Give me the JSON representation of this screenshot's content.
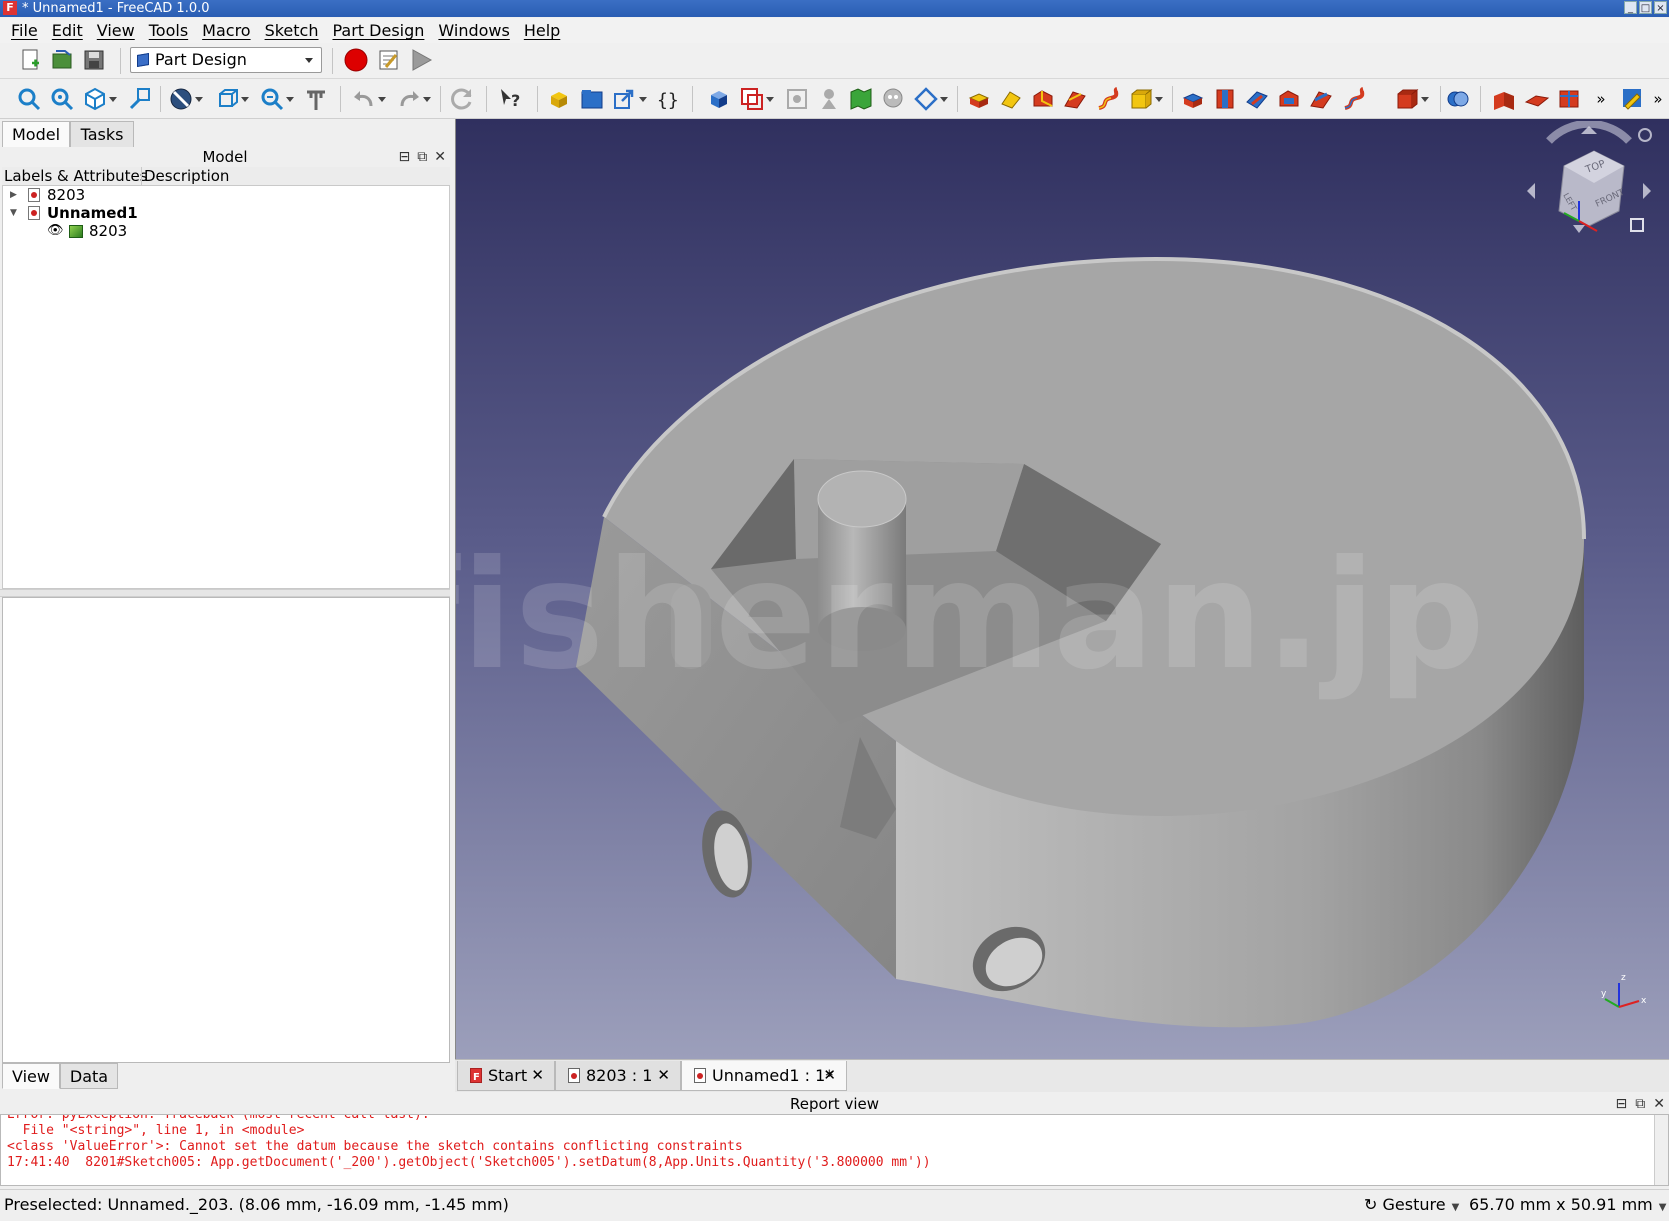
{
  "window": {
    "title": "* Unnamed1 - FreeCAD 1.0.0",
    "app_icon": "freecad-icon"
  },
  "menu": [
    "File",
    "Edit",
    "View",
    "Tools",
    "Macro",
    "Sketch",
    "Part Design",
    "Windows",
    "Help"
  ],
  "toolbar": {
    "workbench": "Part Design"
  },
  "left_panel": {
    "tabs": [
      "Model",
      "Tasks"
    ],
    "title": "Model",
    "columns": [
      "Labels & Attributes",
      "Description"
    ],
    "tree": [
      {
        "label": "8203"
      },
      {
        "label": "Unnamed1"
      },
      {
        "label": "8203"
      }
    ],
    "bottom_tabs": [
      "View",
      "Data"
    ]
  },
  "viewport": {
    "watermark": "© fisherman.jp",
    "navcube": {
      "top": "TOP",
      "front": "FRONT",
      "left": "LEFT"
    },
    "axes": {
      "x": "x",
      "y": "y",
      "z": "z"
    },
    "colors": {
      "bg_top": "#30305f",
      "bg_bottom": "#9c9fbb",
      "part": "#a8a8a8"
    }
  },
  "doc_tabs": [
    {
      "label": "Start"
    },
    {
      "label": "8203 : 1"
    },
    {
      "label": "Unnamed1 : 1*"
    }
  ],
  "report": {
    "title": "Report view",
    "lines": [
      "Error: pyException: Traceback (most recent call last):",
      "  File \"<string>\", line 1, in <module>",
      "<class 'ValueError'>: Cannot set the datum because the sketch contains conflicting constraints",
      "17:41:40  8201#Sketch005: App.getDocument('_200').getObject('Sketch005').setDatum(8,App.Units.Quantity('3.800000 mm'))"
    ]
  },
  "status": {
    "message": "Preselected: Unnamed._203. (8.06 mm, -16.09 mm, -1.45 mm)",
    "navigation": "Gesture",
    "dimensions": "65.70 mm x 50.91 mm"
  }
}
